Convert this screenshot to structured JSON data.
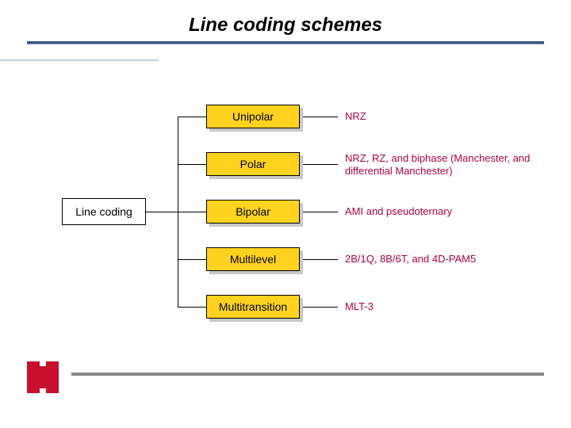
{
  "title": "Line coding schemes",
  "root": {
    "label": "Line coding"
  },
  "categories": [
    {
      "label": "Unipolar",
      "detail": "NRZ"
    },
    {
      "label": "Polar",
      "detail": "NRZ, RZ, and biphase (Manchester, and differential Manchester)"
    },
    {
      "label": "Bipolar",
      "detail": "AMI and pseudoternary"
    },
    {
      "label": "Multilevel",
      "detail": "2B/1Q,  8B/6T, and 4D-PAM5"
    },
    {
      "label": "Multitransition",
      "detail": "MLT-3"
    }
  ],
  "chart_data": {
    "type": "table",
    "title": "Line coding schemes",
    "root": "Line coding",
    "rows": [
      {
        "category": "Unipolar",
        "examples": "NRZ"
      },
      {
        "category": "Polar",
        "examples": "NRZ, RZ, and biphase (Manchester, and differential Manchester)"
      },
      {
        "category": "Bipolar",
        "examples": "AMI and pseudoternary"
      },
      {
        "category": "Multilevel",
        "examples": "2B/1Q, 8B/6T, and 4D-PAM5"
      },
      {
        "category": "Multitransition",
        "examples": "MLT-3"
      }
    ]
  },
  "colors": {
    "accent_rule": "#3b5588",
    "category_fill": "#ffd21f",
    "detail_text": "#b10048",
    "logo_red": "#c8102e"
  }
}
